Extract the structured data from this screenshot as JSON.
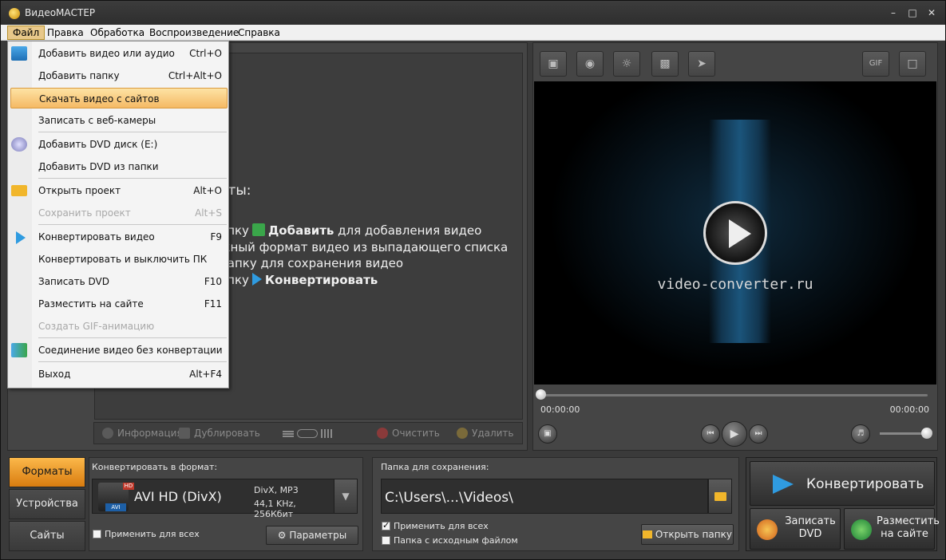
{
  "window": {
    "title": "ВидеоМАСТЕР"
  },
  "menubar": [
    "Файл",
    "Правка",
    "Обработка",
    "Воспроизведение",
    "Справка"
  ],
  "file_menu": [
    {
      "label": "Добавить видео или аудио",
      "shortcut": "Ctrl+O",
      "icon": "add-video-icon",
      "state": "normal"
    },
    {
      "label": "Добавить папку",
      "shortcut": "Ctrl+Alt+O",
      "icon": "",
      "state": "normal"
    },
    {
      "label": "Скачать видео с сайтов",
      "shortcut": "",
      "icon": "",
      "state": "highlighted"
    },
    {
      "label": "Записать с веб-камеры",
      "shortcut": "",
      "icon": "",
      "state": "normal"
    },
    {
      "label": "Добавить DVD диск (E:)",
      "shortcut": "",
      "icon": "dvd-disc-icon",
      "state": "normal"
    },
    {
      "label": "Добавить DVD из папки",
      "shortcut": "",
      "icon": "",
      "state": "normal"
    },
    {
      "label": "Открыть проект",
      "shortcut": "Alt+O",
      "icon": "folder-open-icon",
      "state": "normal"
    },
    {
      "label": "Сохранить проект",
      "shortcut": "Alt+S",
      "icon": "",
      "state": "disabled"
    },
    {
      "label": "Конвертировать видео",
      "shortcut": "F9",
      "icon": "convert-arrow-icon",
      "state": "normal"
    },
    {
      "label": "Конвертировать и выключить ПК",
      "shortcut": "",
      "icon": "",
      "state": "normal"
    },
    {
      "label": "Записать DVD",
      "shortcut": "F10",
      "icon": "",
      "state": "normal"
    },
    {
      "label": "Разместить на сайте",
      "shortcut": "F11",
      "icon": "",
      "state": "normal"
    },
    {
      "label": "Создать GIF-анимацию",
      "shortcut": "",
      "icon": "",
      "state": "disabled"
    },
    {
      "label": "Соединение видео без конвертации",
      "shortcut": "",
      "icon": "join-video-icon",
      "state": "normal"
    },
    {
      "label": "Выход",
      "shortcut": "Alt+F4",
      "icon": "",
      "state": "normal"
    }
  ],
  "help": {
    "title_fragment": "аты:",
    "line1_a": "апку",
    "line1_bold": "Добавить",
    "line1_b": "для добавления видео",
    "line2": "жный формат видео из выпадающего списка",
    "line3": "папку для сохранения видео",
    "line4_a": "опку",
    "line4_bold": "Конвертировать"
  },
  "bottom_toolbar": {
    "info": "Информация",
    "duplicate": "Дублировать",
    "clear": "Очистить",
    "delete": "Удалить"
  },
  "preview": {
    "brand": "video-converter.ru",
    "time_current": "00:00:00",
    "time_total": "00:00:00",
    "gif_label": "GIF",
    "seek_progress": 0,
    "volume_level": 1.0
  },
  "side_tabs": [
    "Форматы",
    "Устройства",
    "Сайты"
  ],
  "format": {
    "panel_label": "Конвертировать в формат:",
    "name": "AVI HD (DivX)",
    "spec1": "DivX, MP3",
    "spec2": "44,1 KHz, 256Кбит",
    "hd_badge": "HD",
    "avi_badge": "AVI",
    "apply_all": "Применить для всех",
    "params_button": "Параметры"
  },
  "save": {
    "panel_label": "Папка для сохранения:",
    "path": "C:\\Users\\...\\Videos\\",
    "apply_all": "Применить для всех",
    "source_folder": "Папка с исходным файлом",
    "open_folder_button": "Открыть папку"
  },
  "actions": {
    "convert": "Конвертировать",
    "burn_dvd": "Записать DVD",
    "publish": "Разместить на сайте"
  },
  "colors": {
    "accent_orange": "#f5a623",
    "menu_highlight": "#f5b964",
    "convert_blue": "#2f9be0"
  }
}
